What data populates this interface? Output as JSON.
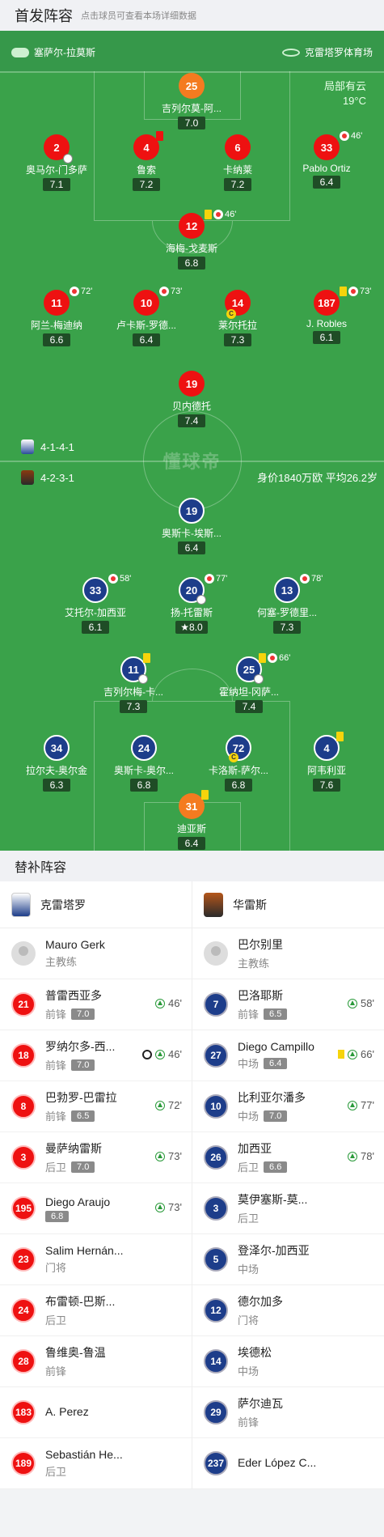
{
  "lineup": {
    "title": "首发阵容",
    "hint": "点击球员可查看本场详细数据"
  },
  "pitch": {
    "referee": "塞萨尔-拉莫斯",
    "stadium": "克雷塔罗体育场",
    "weather": "局部有云",
    "temperature": "19°C",
    "watermark": "懂球帝",
    "home_formation": "4-1-4-1",
    "away_formation": "4-2-3-1",
    "away_summary": "身价1840万欧 平均26.2岁"
  },
  "players": {
    "p25": {
      "number": "25",
      "name": "吉列尔莫-阿...",
      "rating": "7.0"
    },
    "p2": {
      "number": "2",
      "name": "奥马尔-门多萨",
      "rating": "7.1"
    },
    "p4": {
      "number": "4",
      "name": "鲁索",
      "rating": "7.2"
    },
    "p6": {
      "number": "6",
      "name": "卡纳莱",
      "rating": "7.2"
    },
    "p33": {
      "number": "33",
      "name": "Pablo Ortiz",
      "rating": "6.4",
      "event": "46'"
    },
    "p12": {
      "number": "12",
      "name": "海梅-戈麦斯",
      "rating": "6.8",
      "event": "46'"
    },
    "p11": {
      "number": "11",
      "name": "阿兰-梅迪纳",
      "rating": "6.6",
      "event": "72'"
    },
    "p10": {
      "number": "10",
      "name": "卢卡斯-罗德...",
      "rating": "6.4",
      "event": "73'"
    },
    "p14": {
      "number": "14",
      "name": "莱尔托拉",
      "rating": "7.3"
    },
    "p187": {
      "number": "187",
      "name": "J. Robles",
      "rating": "6.1",
      "event": "73'"
    },
    "p19": {
      "number": "19",
      "name": "贝内德托",
      "rating": "7.4"
    },
    "a19": {
      "number": "19",
      "name": "奥斯卡-埃斯...",
      "rating": "6.4"
    },
    "a33": {
      "number": "33",
      "name": "艾托尔-加西亚",
      "rating": "6.1",
      "event": "58'"
    },
    "a20": {
      "number": "20",
      "name": "扬-托雷斯",
      "rating": "8.0",
      "event": "77'"
    },
    "a13": {
      "number": "13",
      "name": "何塞-罗德里...",
      "rating": "7.3",
      "event": "78'"
    },
    "a11": {
      "number": "11",
      "name": "吉列尔梅-卡...",
      "rating": "7.3"
    },
    "a25": {
      "number": "25",
      "name": "霍纳坦-冈萨...",
      "rating": "7.4",
      "event": "66'"
    },
    "a34": {
      "number": "34",
      "name": "拉尔夫-奥尔金",
      "rating": "6.3"
    },
    "a24": {
      "number": "24",
      "name": "奥斯卡-奥尔...",
      "rating": "6.8"
    },
    "a72": {
      "number": "72",
      "name": "卡洛斯-萨尔...",
      "rating": "6.8"
    },
    "a4": {
      "number": "4",
      "name": "阿韦利亚",
      "rating": "7.6"
    },
    "a31": {
      "number": "31",
      "name": "迪亚斯",
      "rating": "6.4"
    }
  },
  "subs": {
    "title": "替补阵容",
    "home": {
      "team": "克雷塔罗",
      "coach": {
        "name": "Mauro Gerk",
        "role": "主教练"
      },
      "rows": [
        {
          "number": "21",
          "name": "普雷西亚多",
          "pos": "前锋",
          "rating": "7.0",
          "time": "46'"
        },
        {
          "number": "18",
          "name": "罗纳尔多-西...",
          "pos": "前锋",
          "rating": "7.0",
          "time": "46'"
        },
        {
          "number": "8",
          "name": "巴勃罗-巴雷拉",
          "pos": "前锋",
          "rating": "6.5",
          "time": "72'"
        },
        {
          "number": "3",
          "name": "曼萨纳雷斯",
          "pos": "后卫",
          "rating": "7.0",
          "time": "73'"
        },
        {
          "number": "195",
          "name": "Diego Araujo",
          "pos": "",
          "rating": "6.8",
          "time": "73'"
        },
        {
          "number": "23",
          "name": "Salim Hernán...",
          "pos": "门将"
        },
        {
          "number": "24",
          "name": "布雷顿-巴斯...",
          "pos": "后卫"
        },
        {
          "number": "28",
          "name": "鲁维奥-鲁温",
          "pos": "前锋"
        },
        {
          "number": "183",
          "name": "A. Perez",
          "pos": ""
        },
        {
          "number": "189",
          "name": "Sebastián He...",
          "pos": "后卫"
        }
      ]
    },
    "away": {
      "team": "华雷斯",
      "coach": {
        "name": "巴尔别里",
        "role": "主教练"
      },
      "rows": [
        {
          "number": "7",
          "name": "巴洛耶斯",
          "pos": "前锋",
          "rating": "6.5",
          "time": "58'"
        },
        {
          "number": "27",
          "name": "Diego Campillo",
          "pos": "中场",
          "rating": "6.4",
          "time": "66'"
        },
        {
          "number": "10",
          "name": "比利亚尔潘多",
          "pos": "中场",
          "rating": "7.0",
          "time": "77'"
        },
        {
          "number": "26",
          "name": "加西亚",
          "pos": "后卫",
          "rating": "6.6",
          "time": "78'"
        },
        {
          "number": "3",
          "name": "莫伊塞斯-莫...",
          "pos": "后卫"
        },
        {
          "number": "5",
          "name": "登泽尔-加西亚",
          "pos": "中场"
        },
        {
          "number": "12",
          "name": "德尔加多",
          "pos": "门将"
        },
        {
          "number": "14",
          "name": "埃德松",
          "pos": "中场"
        },
        {
          "number": "29",
          "name": "萨尔迪瓦",
          "pos": "前锋"
        },
        {
          "number": "237",
          "name": "Eder López C...",
          "pos": ""
        }
      ]
    }
  },
  "colors": {
    "home": "#e11111",
    "away": "#1d3d8a",
    "pitch": "#3aa24a"
  }
}
